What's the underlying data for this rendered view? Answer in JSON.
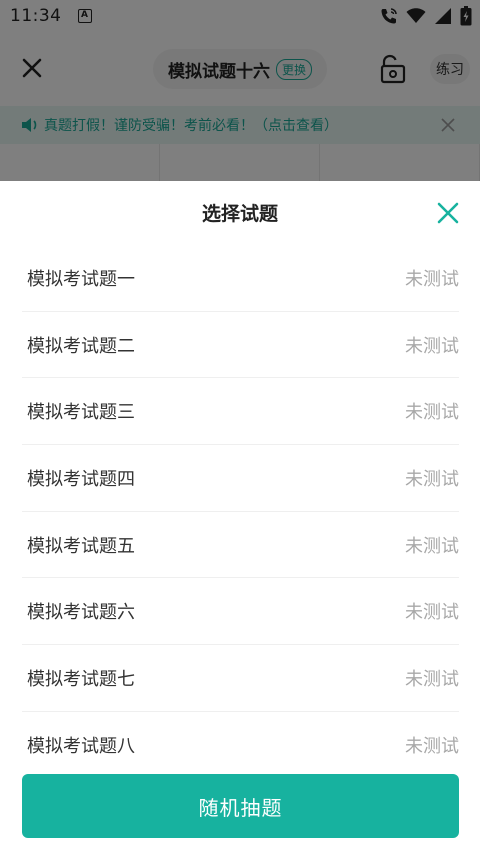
{
  "status_bar": {
    "time": "11:34",
    "a_icon_label": "A"
  },
  "nav": {
    "title": "模拟试题十六",
    "swap_label": "更换",
    "practice_label": "练习"
  },
  "notice": {
    "text": "真题打假！谨防受骗！考前必看！（点击查看）"
  },
  "sheet": {
    "title": "选择试题",
    "items": [
      {
        "name": "模拟考试题一",
        "status": "未测试"
      },
      {
        "name": "模拟考试题二",
        "status": "未测试"
      },
      {
        "name": "模拟考试题三",
        "status": "未测试"
      },
      {
        "name": "模拟考试题四",
        "status": "未测试"
      },
      {
        "name": "模拟考试题五",
        "status": "未测试"
      },
      {
        "name": "模拟考试题六",
        "status": "未测试"
      },
      {
        "name": "模拟考试题七",
        "status": "未测试"
      },
      {
        "name": "模拟考试题八",
        "status": "未测试"
      }
    ],
    "random_button_label": "随机抽题"
  },
  "colors": {
    "accent": "#17b29f",
    "status_text": "#a8a8a8",
    "overlay": "rgba(0,0,0,0.5)"
  },
  "icons": {
    "close": "close-icon",
    "lock": "unlock-icon",
    "speaker": "speaker-icon",
    "call": "wifi-call-icon",
    "wifi": "wifi-icon",
    "signal": "signal-icon",
    "battery": "battery-icon"
  }
}
